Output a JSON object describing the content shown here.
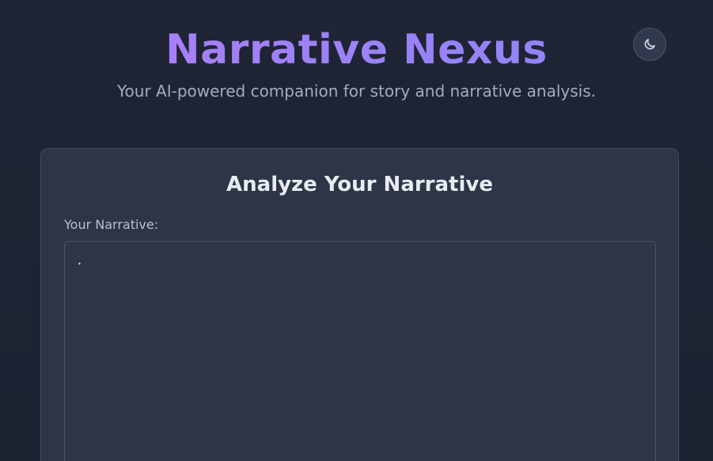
{
  "header": {
    "title": "Narrative Nexus",
    "subtitle": "Your AI-powered companion for story and narrative analysis."
  },
  "theme_toggle": {
    "icon": "moon-icon"
  },
  "analyze_card": {
    "title": "Analyze Your Narrative",
    "narrative_label": "Your Narrative:",
    "narrative_value": "."
  },
  "colors": {
    "background": "#1e2433",
    "card": "#2d3547",
    "title_gradient_start": "#b07df5",
    "title_gradient_end": "#8a86f6",
    "subtitle_text": "#a3acbc"
  }
}
